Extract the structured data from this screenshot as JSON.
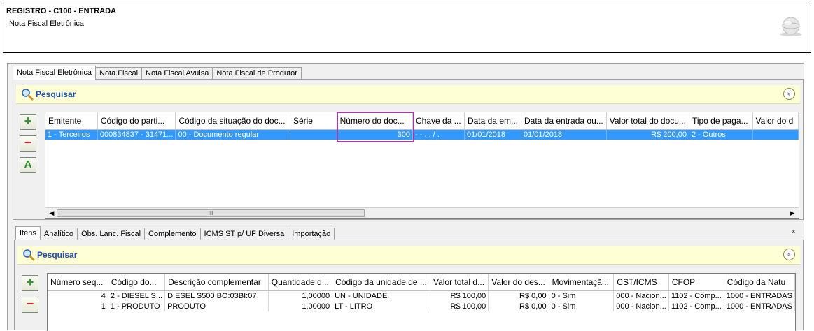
{
  "header": {
    "title": "REGISTRO - C100 - ENTRADA",
    "subtitle": "Nota Fiscal Eletrônica"
  },
  "top_tabs": [
    "Nota Fiscal Eletrônica",
    "Nota Fiscal",
    "Nota Fiscal Avulsa",
    "Nota Fiscal de Produtor"
  ],
  "top_search": {
    "label": "Pesquisar",
    "expand": "»"
  },
  "side_buttons": {
    "add": "+",
    "remove": "−",
    "abc": "A"
  },
  "top_grid": {
    "columns": [
      "Emitente",
      "Código do parti...",
      "Código da situação do doc...",
      "Série",
      "Número do doc...",
      "Chave da ...",
      "Data da em...",
      "Data da entrada ou...",
      "Valor total do docu...",
      "Tipo de paga...",
      "Valor do d"
    ],
    "rows": [
      [
        "1 - Terceiros",
        "000834837 - 31471...",
        "00 - Documento regular",
        "",
        "300",
        " -   -  .   .   /   .",
        "01/01/2018",
        "01/01/2018",
        "R$ 200,00",
        "2 - Outros",
        ""
      ]
    ],
    "scroll_thumb": "III"
  },
  "bottom_tabs": [
    "Itens",
    "Analítico",
    "Obs. Lanc. Fiscal",
    "Complemento",
    "ICMS ST p/ UF Diversa",
    "Importação"
  ],
  "close_label": "×",
  "bottom_search": {
    "label": "Pesquisar",
    "expand": "»"
  },
  "bottom_grid": {
    "columns": [
      "Número seq...",
      "Código do...",
      "Descrição complementar",
      "Quantidade d...",
      "Código da unidade de ...",
      "Valor total d...",
      "Valor do des...",
      "Movimentaçã...",
      "CST/ICMS",
      "CFOP",
      "Código da Natu"
    ],
    "rows": [
      [
        "4",
        "2 - DIESEL S...",
        "DIESEL S500 BO:03BI:07",
        "1,00000",
        "UN - UNIDADE",
        "R$ 100,00",
        "R$ 0,00",
        "0 - Sim",
        "000 - Nacion...",
        "1102 - Comp...",
        "1000 - ENTRADAS"
      ],
      [
        "1",
        "1 - PRODUTO",
        "PRODUTO",
        "1,00000",
        "LT - LITRO",
        "R$ 100,00",
        "R$ 0,00",
        "0 - Sim",
        "000 - Nacion...",
        "1102 - Comp...",
        "1000 - ENTRADAS"
      ]
    ]
  },
  "colors": {
    "selection": "#3399ff",
    "search_bg": "#ffffd5",
    "search_text": "#1f4fb3",
    "highlight": "#a040a0"
  }
}
